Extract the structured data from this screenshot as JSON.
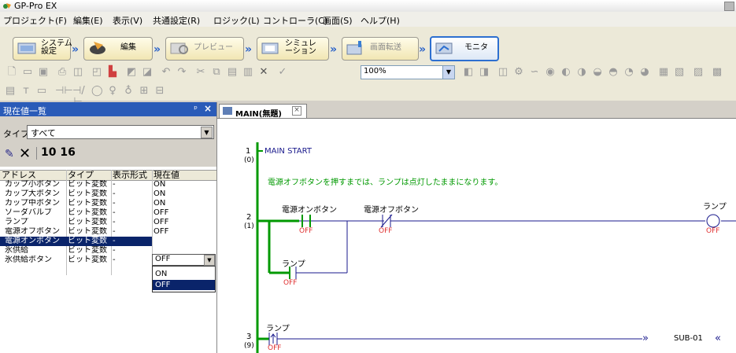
{
  "app": {
    "title": "GP-Pro EX"
  },
  "menu": [
    "プロジェクト(F)",
    "編集(E)",
    "表示(V)",
    "共通設定(R)",
    "ロジック(L)",
    "コントローラ(C)",
    "画面(S)",
    "ヘルプ(H)"
  ],
  "workflow": {
    "system": "システム\n設定",
    "edit": "編集",
    "preview": "プレビュー",
    "simulation": "シミュレ\nーション",
    "transfer": "画面転送",
    "monitor": "モニタ"
  },
  "toolbar": {
    "zoom": "100%"
  },
  "panel": {
    "title": "現在値一覧",
    "pin": "ᵖ",
    "close": "×",
    "type_label": "タイプ",
    "type_value": "すべて",
    "counter": "10 16",
    "columns": [
      "アドレス",
      "タイプ",
      "表示形式",
      "現在値"
    ],
    "rows": [
      [
        "カップ小ボタン",
        "ビット変数",
        "-",
        "ON"
      ],
      [
        "カップ大ボタン",
        "ビット変数",
        "-",
        "ON"
      ],
      [
        "カップ中ボタン",
        "ビット変数",
        "-",
        "ON"
      ],
      [
        "ソーダバルブ",
        "ビット変数",
        "-",
        "OFF"
      ],
      [
        "ランプ",
        "ビット変数",
        "-",
        "OFF"
      ],
      [
        "電源オフボタン",
        "ビット変数",
        "-",
        "OFF"
      ],
      [
        "電源オンボタン",
        "ビット変数",
        "-",
        "OFF"
      ],
      [
        "氷供給",
        "ビット変数",
        "-",
        "OFF"
      ],
      [
        "氷供給ボタン",
        "ビット変数",
        "-",
        "OFF"
      ]
    ],
    "edit_value": "OFF",
    "dropdown_options": [
      "ON",
      "OFF"
    ]
  },
  "editor": {
    "tab_label": "MAIN(無題)",
    "rung1_num": "1",
    "rung1_step": "(0)",
    "rung1_label": "MAIN START",
    "comment": "電源オフボタンを押すまでは、ランプは点灯したままになります。",
    "rung2_num": "2",
    "rung2_step": "(1)",
    "contact_on": "電源オンボタン",
    "contact_off": "電源オフボタン",
    "coil": "ランプ",
    "contact_lamp": "ランプ",
    "state_off": "OFF",
    "rung3_num": "3",
    "rung3_step": "(9)",
    "rung3_contact": "ランプ",
    "jump_target": "SUB-01"
  },
  "colors": {
    "accent": "#2a5bb8",
    "selection": "#0a246a",
    "ladder_green": "#009900",
    "ladder_blue": "#1a1a8c",
    "state_red": "#e03030"
  }
}
